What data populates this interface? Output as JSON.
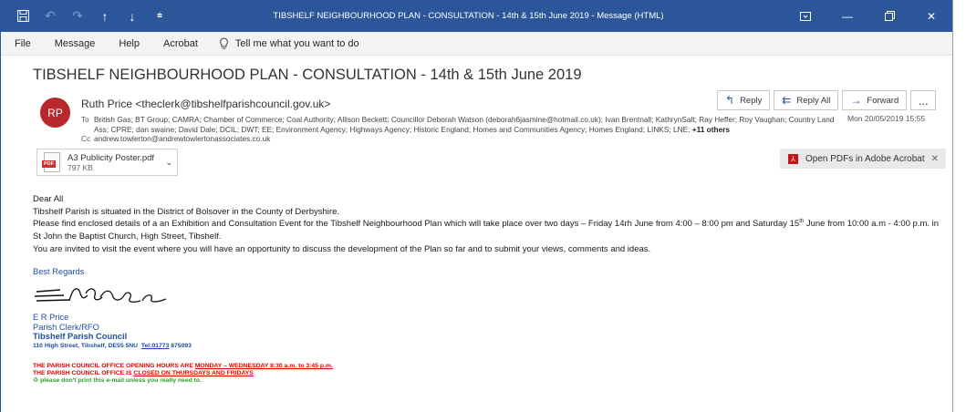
{
  "window": {
    "title": "TIBSHELF NEIGHBOURHOOD PLAN - CONSULTATION - 14th & 15th June 2019  -  Message (HTML)",
    "qat_icons": [
      "save-icon",
      "undo-icon",
      "redo-icon",
      "up-arrow-icon",
      "down-arrow-icon",
      "customize-icon"
    ],
    "controls": [
      "ribbon-display-icon",
      "minimize-icon",
      "restore-icon",
      "close-icon"
    ],
    "accent_color": "#2b579a"
  },
  "menu": {
    "items": [
      "File",
      "Message",
      "Help",
      "Acrobat"
    ],
    "tell_me": "Tell me what you want to do"
  },
  "message": {
    "subject": "TIBSHELF NEIGHBOURHOOD PLAN - CONSULTATION - 14th & 15th June 2019",
    "avatar_initials": "RP",
    "avatar_color": "#b9282d",
    "sender": "Ruth Price <theclerk@tibshelfparishcouncil.gov.uk>",
    "to_label": "To",
    "to_text": "British Gas; BT Group; CAMRA; Chamber of Commerce; Coal Authority; Allison Beckett; Councillor Deborah Watson (deborah6jasmine@hotmail.co.uk); Ivan Brentnall; KathrynSalt; Ray Heffer; Roy Vaughan; Country Land Ass; CPRE; dan swaine; David Dale; DCIL; DWT; EE; Environment Agency; Highways Agency; Historic England; Homes and Communities Agency; Homes England; LINKS; LNE;",
    "to_more": "+11 others",
    "cc_label": "Cc",
    "cc_text": "andrew.towlerton@andrewtowlertonassociates.co.uk",
    "date": "Mon 20/05/2019 15:55",
    "actions": {
      "reply": "Reply",
      "reply_all": "Reply All",
      "forward": "Forward",
      "more": "..."
    },
    "attachment": {
      "name": "A3 Publicity Poster.pdf",
      "size": "797 KB",
      "badge": "PDF"
    },
    "acrobat_bar": "Open PDFs in Adobe Acrobat"
  },
  "body": {
    "greeting": "Dear All",
    "line1": "Tibshelf Parish is situated in the District of Bolsover in the County of Derbyshire.",
    "line2_a": "Please find enclosed details of a an Exhibition and Consultation Event for the Tibshelf Neighbourhood Plan which will take place over two days – Friday 14rh June from 4:00 – 8:00 pm and Saturday 15",
    "line2_sup": "th",
    "line2_b": " June from 10:00 a.m - 4:00 p.m. in St John the Baptist Church, High Street, Tibshelf.",
    "line3": "You are invited to visit the event where you will have an opportunity to discuss the development of the Plan so far and to submit your views, comments and ideas."
  },
  "signature": {
    "regards": "Best Regards",
    "name": "E R Price",
    "role": "Parish Clerk/RFO",
    "org": "Tibshelf Parish Council",
    "address": "110 High Street, Tibshelf, DE55 5NU",
    "tel_label": "Tel:01773",
    "tel_rest": " 875093",
    "hours_prefix": "THE PARISH COUNCIL OFFICE OPENING HOURS ARE ",
    "hours_link": "MONDAY – WEDNESDAY  8:30 a.m. to 3:45 p.m.",
    "closed_prefix": "THE PARISH COUNCIL OFFICE IS ",
    "closed_link": "CLOSED ON THURSDAYS AND FRIDAYS",
    "eco_note": "please don't print this e-mail unless you really need to."
  }
}
